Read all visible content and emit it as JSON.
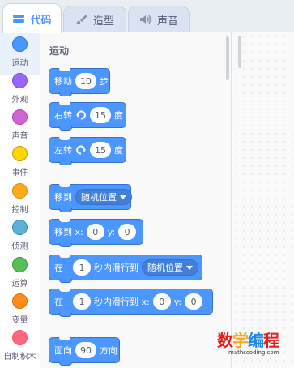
{
  "tabs": [
    {
      "label": "代码",
      "icon": "code-icon",
      "active": true
    },
    {
      "label": "造型",
      "icon": "brush-icon",
      "active": false
    },
    {
      "label": "声音",
      "icon": "speaker-icon",
      "active": false
    }
  ],
  "categories": [
    {
      "label": "运动",
      "color": "#4c97ff",
      "selected": true
    },
    {
      "label": "外观",
      "color": "#9966ff",
      "selected": false
    },
    {
      "label": "声音",
      "color": "#cf63cf",
      "selected": false
    },
    {
      "label": "事件",
      "color": "#ffd500",
      "selected": false
    },
    {
      "label": "控制",
      "color": "#ffab19",
      "selected": false
    },
    {
      "label": "侦测",
      "color": "#5cb1d6",
      "selected": false
    },
    {
      "label": "运算",
      "color": "#59c059",
      "selected": false
    },
    {
      "label": "变量",
      "color": "#ff8c1a",
      "selected": false
    },
    {
      "label": "自制积木",
      "color": "#ff6680",
      "selected": false
    }
  ],
  "palette": {
    "section_title": "运动",
    "blocks": {
      "move": {
        "text1": "移动",
        "value": "10",
        "text2": "步"
      },
      "turn_right": {
        "text1": "右转",
        "value": "15",
        "text2": "度",
        "icon": "rotate-clockwise-icon"
      },
      "turn_left": {
        "text1": "左转",
        "value": "15",
        "text2": "度",
        "icon": "rotate-counterclockwise-icon"
      },
      "goto": {
        "text1": "移到",
        "dropdown": "随机位置"
      },
      "goto_xy": {
        "text1": "移到 x:",
        "x": "0",
        "text2": "y:",
        "y": "0"
      },
      "glide": {
        "text1": "在",
        "secs": "1",
        "text2": "秒内滑行到",
        "dropdown": "随机位置"
      },
      "glide_xy": {
        "text1": "在",
        "secs": "1",
        "text2": "秒内滑行到 x:",
        "x": "0",
        "text3": "y:",
        "y": "0"
      },
      "point": {
        "text1": "面向",
        "value": "90",
        "text2": "方向"
      }
    }
  },
  "watermark": {
    "chars": [
      "数",
      "学",
      "编",
      "程"
    ],
    "colors": [
      "#e02020",
      "#f5a623",
      "#1e88e5",
      "#e02020"
    ],
    "sub": "mathscoding.com"
  }
}
